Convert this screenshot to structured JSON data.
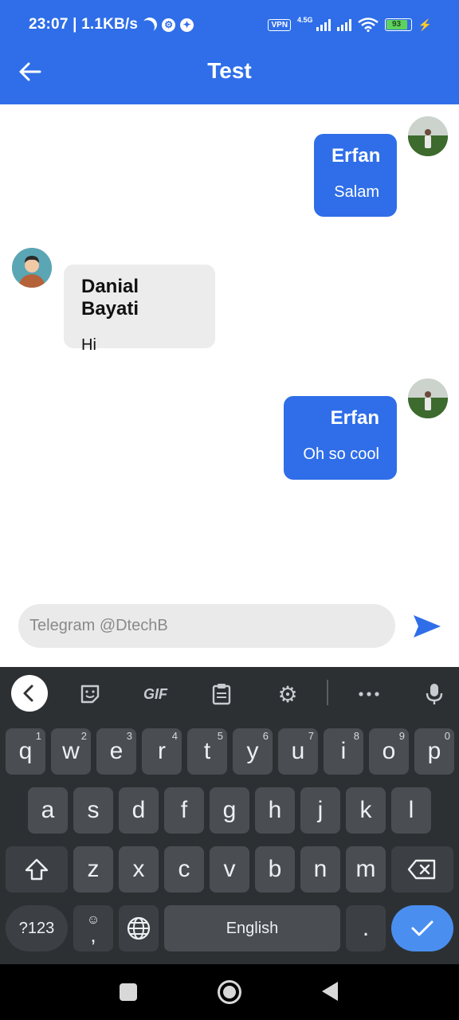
{
  "status_bar": {
    "time_speed": "23:07 | 1.1KB/s",
    "vpn": "VPN",
    "network": "4.5G",
    "battery": "93"
  },
  "header": {
    "title": "Test"
  },
  "messages": [
    {
      "sender": "Erfan",
      "text": "Salam",
      "side": "right"
    },
    {
      "sender": "Danial Bayati",
      "text": "Hi",
      "side": "left"
    },
    {
      "sender": "Erfan",
      "text": "Oh so cool",
      "side": "right"
    }
  ],
  "composer": {
    "placeholder": "Telegram @DtechB"
  },
  "keyboard": {
    "toolbar": {
      "gif": "GIF"
    },
    "row1": [
      "q",
      "w",
      "e",
      "r",
      "t",
      "y",
      "u",
      "i",
      "o",
      "p"
    ],
    "row1_numbers": [
      "1",
      "2",
      "3",
      "4",
      "5",
      "6",
      "7",
      "8",
      "9",
      "0"
    ],
    "row2": [
      "a",
      "s",
      "d",
      "f",
      "g",
      "h",
      "j",
      "k",
      "l"
    ],
    "row3": [
      "z",
      "x",
      "c",
      "v",
      "b",
      "n",
      "m"
    ],
    "symbols_key": "?123",
    "comma_key": ",",
    "space_label": "English",
    "period_key": "."
  },
  "colors": {
    "accent": "#2f6ee8",
    "incoming_bubble": "#ececec",
    "keyboard_bg": "#2d3033",
    "enter_key": "#4a8ff0"
  }
}
